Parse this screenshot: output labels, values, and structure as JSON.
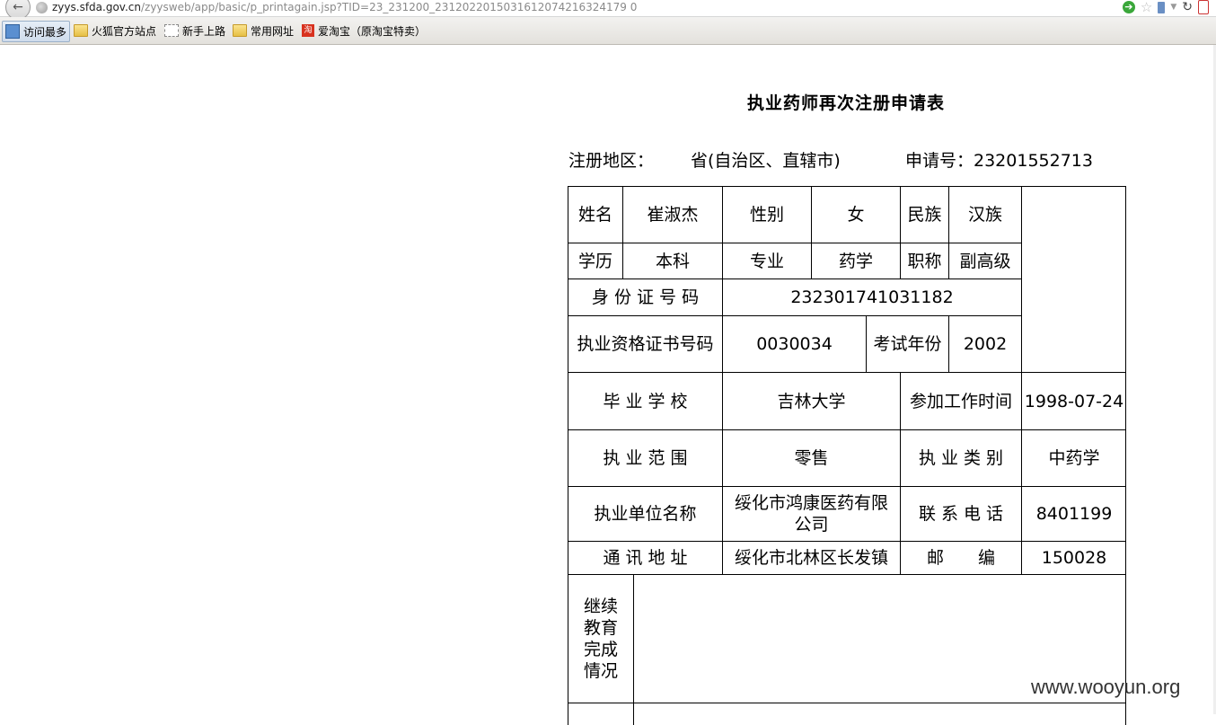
{
  "browser": {
    "url_host": "zyys.sfda.gov.cn",
    "url_path": "/zyysweb/app/basic/p_printagain.jsp?TID=23_231200_2312022015031612074216324179 0"
  },
  "bookmarks": [
    {
      "label": "访问最多",
      "icon": "most-visited-icon"
    },
    {
      "label": "火狐官方站点",
      "icon": "folder-icon"
    },
    {
      "label": "新手上路",
      "icon": "blank-page-icon"
    },
    {
      "label": "常用网址",
      "icon": "folder-icon"
    },
    {
      "label": "爱淘宝（原淘宝特卖）",
      "icon": "taobao-icon"
    }
  ],
  "form": {
    "title": "执业药师再次注册申请表",
    "region_label": "注册地区：",
    "province_label": "省(自治区、直辖市)",
    "app_no_label": "申请号：23201552713",
    "name_label": "姓名",
    "name": "崔淑杰",
    "gender_label": "性别",
    "gender": "女",
    "ethnicity_label": "民族",
    "ethnicity": "汉族",
    "education_label": "学历",
    "education": "本科",
    "major_label": "专业",
    "major": "药学",
    "title_label": "职称",
    "title_value": "副高级",
    "id_label": "身 份 证 号 码",
    "id_number": "232301741031182",
    "cert_label": "执业资格证书号码",
    "cert_number": "0030034",
    "exam_year_label": "考试年份",
    "exam_year": "2002",
    "school_label": "毕 业 学 校",
    "school": "吉林大学",
    "work_start_label": "参加工作时间",
    "work_start": "1998-07-24",
    "scope_label": "执 业 范 围",
    "scope": "零售",
    "category_label": "执 业 类 别",
    "category": "中药学",
    "employer_label": "执业单位名称",
    "employer": "绥化市鸿康医药有限公司",
    "phone_label": "联 系 电 话",
    "phone": "8401199",
    "address_label": "通 讯 地 址",
    "address": "绥化市北林区长发镇",
    "postcode_label": "邮　　编",
    "postcode": "150028",
    "cont_edu_label": "继续教育完成情况",
    "cont_edu": ""
  },
  "watermark": "www.wooyun.org"
}
